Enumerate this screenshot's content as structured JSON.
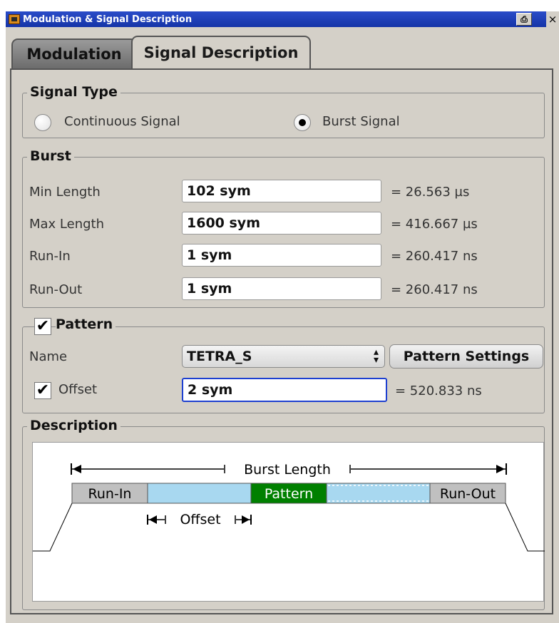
{
  "window": {
    "title": "Modulation & Signal Description",
    "close_glyph": "×",
    "restore_glyph": "⎙"
  },
  "tabs": [
    {
      "label": "Modulation",
      "active": false
    },
    {
      "label": "Signal Description",
      "active": true
    }
  ],
  "signal_type": {
    "legend": "Signal Type",
    "options": [
      {
        "label": "Continuous Signal",
        "selected": false
      },
      {
        "label": "Burst Signal",
        "selected": true
      }
    ]
  },
  "burst": {
    "legend": "Burst",
    "rows": [
      {
        "label": "Min Length",
        "value": "102 sym",
        "result": "= 26.563 µs"
      },
      {
        "label": "Max Length",
        "value": "1600 sym",
        "result": "= 416.667 µs"
      },
      {
        "label": "Run-In",
        "value": "1 sym",
        "result": "= 260.417 ns"
      },
      {
        "label": "Run-Out",
        "value": "1 sym",
        "result": "= 260.417 ns"
      }
    ]
  },
  "pattern": {
    "legend": "Pattern",
    "enabled": true,
    "name_label": "Name",
    "name_value": "TETRA_S",
    "settings_button": "Pattern Settings",
    "offset_label": "Offset",
    "offset_enabled": true,
    "offset_value": "2 sym",
    "offset_result": "= 520.833 ns"
  },
  "description": {
    "legend": "Description",
    "diagram": {
      "burst_length": "Burst Length",
      "run_in": "Run-In",
      "pattern": "Pattern",
      "run_out": "Run-Out",
      "offset": "Offset"
    }
  },
  "colors": {
    "title_bar": "#1534a8",
    "pattern_fill": "#008000",
    "burst_fill": "#a8d8f0",
    "run_fill": "#c0c0c0",
    "focus_border": "#1d3fd0"
  }
}
